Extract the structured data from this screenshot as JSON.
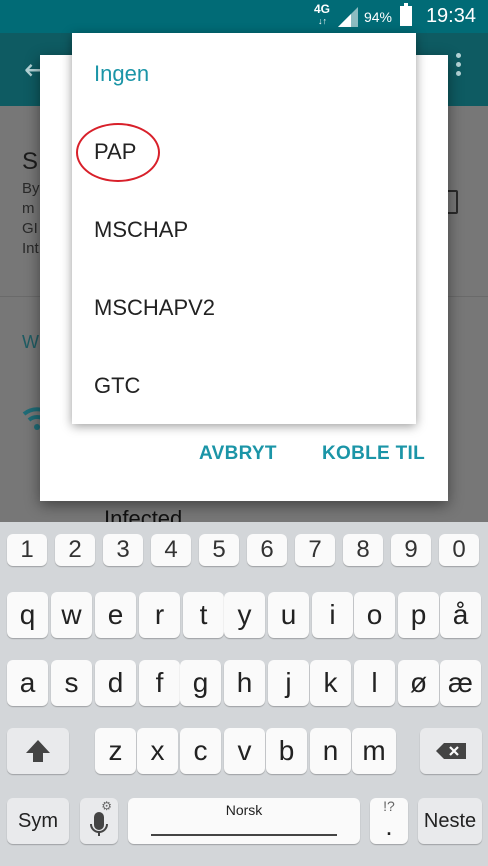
{
  "status_bar": {
    "network": "4G",
    "network_arrows": "↓↑",
    "battery": "94%",
    "time": "19:34"
  },
  "background": {
    "title": "S",
    "lines": [
      "By",
      "m",
      "GI",
      "Int"
    ],
    "section": "W",
    "network_name": "Infected"
  },
  "dropdown": {
    "options": [
      "Ingen",
      "PAP",
      "MSCHAP",
      "MSCHAPV2",
      "GTC"
    ],
    "selected_index": 0,
    "highlighted": "PAP"
  },
  "dialog": {
    "cancel_label": "AVBRYT",
    "connect_label": "KOBLE TIL"
  },
  "keyboard": {
    "numbers": [
      "1",
      "2",
      "3",
      "4",
      "5",
      "6",
      "7",
      "8",
      "9",
      "0"
    ],
    "row1": [
      "q",
      "w",
      "e",
      "r",
      "t",
      "y",
      "u",
      "i",
      "o",
      "p",
      "å"
    ],
    "row2": [
      "a",
      "s",
      "d",
      "f",
      "g",
      "h",
      "j",
      "k",
      "l",
      "ø",
      "æ"
    ],
    "row3": [
      "z",
      "x",
      "c",
      "v",
      "b",
      "n",
      "m"
    ],
    "sym_label": "Sym",
    "space_label": "Norsk",
    "punct_top": "!?",
    "punct_main": ".",
    "next_label": "Neste",
    "mic_extra": "⚙"
  },
  "colors": {
    "accent": "#1b95a7",
    "highlight_circle": "#d8202a",
    "status_bar": "#016b76"
  }
}
